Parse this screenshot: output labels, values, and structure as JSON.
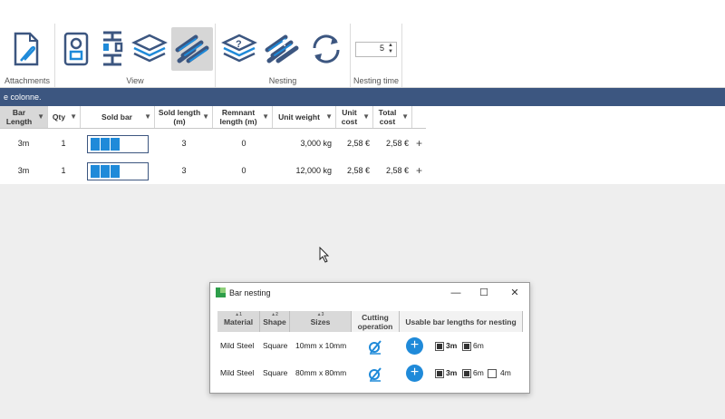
{
  "ribbon": {
    "groups": [
      {
        "label": "Attachments"
      },
      {
        "label": "View"
      },
      {
        "label": "Nesting"
      },
      {
        "label": "Nesting time"
      }
    ],
    "icons": [
      "attachment-document-icon",
      "profile-view-icon",
      "bar-shapes-icon",
      "layers-view-icon",
      "bar-bundle-icon",
      "layers-question-icon",
      "bar-bundle-question-icon",
      "refresh-icon"
    ],
    "nesting_time_value": "5"
  },
  "banner": {
    "text": "e colonne."
  },
  "grid": {
    "columns": [
      "Bar Length",
      "Qty",
      "Sold bar",
      "Sold length (m)",
      "Remnant length (m)",
      "Unit weight",
      "Unit cost",
      "Total cost"
    ],
    "rows": [
      {
        "bar_length": "3m",
        "qty": "1",
        "sold_length": "3",
        "remnant": "0",
        "unit_weight": "3,000 kg",
        "unit_cost": "2,58 €",
        "total_cost": "2,58 €",
        "add": "+"
      },
      {
        "bar_length": "3m",
        "qty": "1",
        "sold_length": "3",
        "remnant": "0",
        "unit_weight": "12,000 kg",
        "unit_cost": "2,58 €",
        "total_cost": "2,58 €",
        "add": "+"
      }
    ]
  },
  "dialog": {
    "title": "Bar nesting",
    "controls": {
      "minimize": "—",
      "maximize": "☐",
      "close": "✕"
    },
    "columns": [
      "Material",
      "Shape",
      "Sizes",
      "Cutting operation",
      "Usable bar lengths for nesting"
    ],
    "sort_markers": [
      "▲1",
      "▲2",
      "▲3"
    ],
    "rows": [
      {
        "material": "Mild Steel",
        "shape": "Square",
        "sizes": "10mm x 10mm",
        "add": "+",
        "lengths": [
          {
            "label": "3m",
            "checked": true
          },
          {
            "label": "6m",
            "checked": true
          }
        ]
      },
      {
        "material": "Mild Steel",
        "shape": "Square",
        "sizes": "80mm x 80mm",
        "add": "+",
        "lengths": [
          {
            "label": "3m",
            "checked": true
          },
          {
            "label": "6m",
            "checked": true
          },
          {
            "label": "4m",
            "checked": false
          }
        ]
      }
    ]
  },
  "colors": {
    "accent": "#1f8ad9",
    "banner": "#3c5680",
    "ribbon_icon": "#3c5680"
  }
}
